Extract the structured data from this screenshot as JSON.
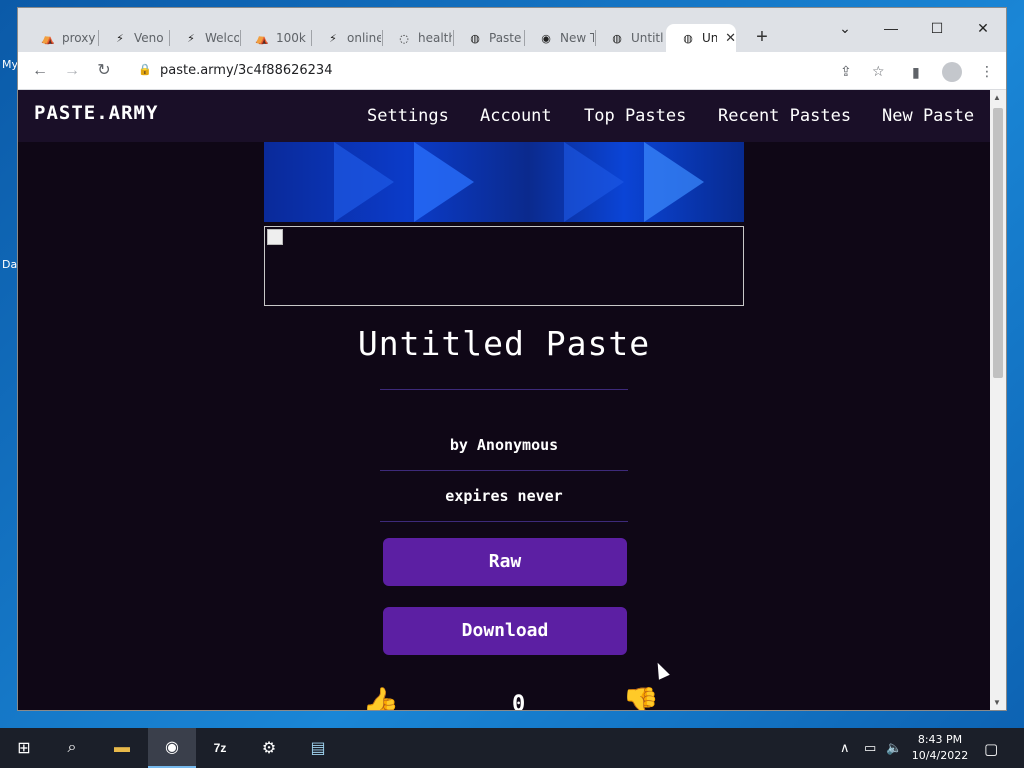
{
  "desktop": {
    "labels": [
      "My",
      "Da"
    ]
  },
  "tabs": [
    {
      "title": "proxy",
      "icon": "tent-icon"
    },
    {
      "title": "Veno",
      "icon": "pulse-icon"
    },
    {
      "title": "Welco",
      "icon": "pulse-icon"
    },
    {
      "title": "100k",
      "icon": "tent-icon"
    },
    {
      "title": "online",
      "icon": "pulse-icon"
    },
    {
      "title": "health",
      "icon": "loading-icon"
    },
    {
      "title": "Paste",
      "icon": "globe-icon"
    },
    {
      "title": "New T",
      "icon": "chrome-icon"
    },
    {
      "title": "Untitl",
      "icon": "globe-icon"
    },
    {
      "title": "Un",
      "icon": "globe-icon",
      "active": true
    }
  ],
  "toolbar": {
    "url": "paste.army/3c4f88626234"
  },
  "site": {
    "logo": "PASTE.ARMY",
    "nav": [
      "Settings",
      "Account",
      "Top Pastes",
      "Recent Pastes",
      "New Paste"
    ]
  },
  "paste": {
    "title": "Untitled Paste",
    "author": "by Anonymous",
    "expires": "expires never",
    "raw_label": "Raw",
    "download_label": "Download",
    "vote_count": "0"
  },
  "taskbar": {
    "time": "8:43 PM",
    "date": "10/4/2022",
    "apps": [
      "windows-icon",
      "search-icon",
      "file-explorer-icon",
      "chrome-icon",
      "7zip-icon",
      "settings-icon",
      "notepad-icon"
    ]
  },
  "colors": {
    "page_bg": "#0f0716",
    "nav_bg": "#1a0f28",
    "button": "#5c1fa3",
    "divider": "#3d2a7a"
  }
}
